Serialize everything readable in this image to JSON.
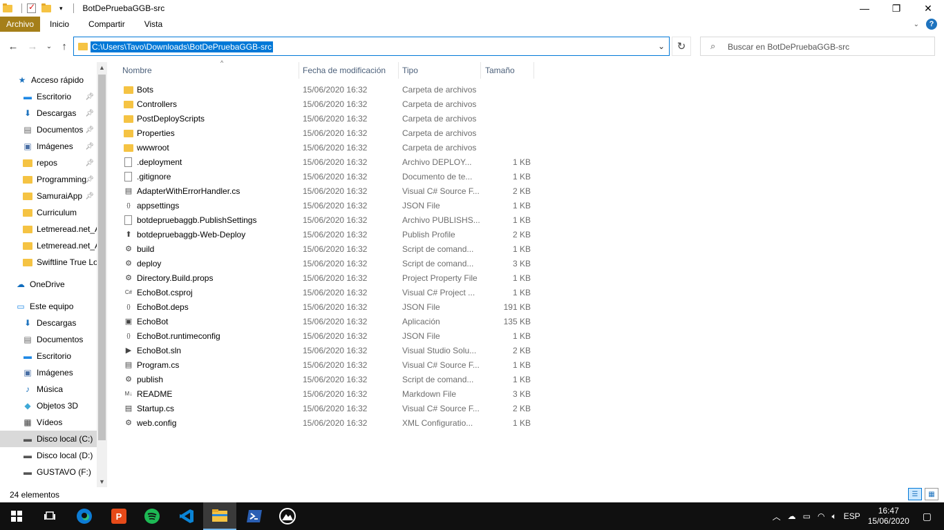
{
  "window": {
    "title": "BotDePruebaGGB-src",
    "controls": {
      "minimize": "—",
      "maximize": "❐",
      "close": "✕"
    }
  },
  "ribbon": {
    "tabs": [
      "Archivo",
      "Inicio",
      "Compartir",
      "Vista"
    ]
  },
  "address": {
    "path": "C:\\Users\\Tavo\\Downloads\\BotDePruebaGGB-src"
  },
  "search": {
    "placeholder": "Buscar en BotDePruebaGGB-src"
  },
  "nav": {
    "items": [
      {
        "label": "Acceso rápido",
        "icon": "star-icon",
        "pinned": false
      },
      {
        "label": "Escritorio",
        "icon": "desktop-icon",
        "pinned": true
      },
      {
        "label": "Descargas",
        "icon": "download-icon",
        "pinned": true
      },
      {
        "label": "Documentos",
        "icon": "documents-icon",
        "pinned": true
      },
      {
        "label": "Imágenes",
        "icon": "pictures-icon",
        "pinned": true
      },
      {
        "label": "repos",
        "icon": "folder-icon",
        "pinned": true
      },
      {
        "label": "Programming",
        "icon": "folder-icon",
        "pinned": true
      },
      {
        "label": "SamuraiApp",
        "icon": "folder-icon",
        "pinned": true
      },
      {
        "label": "Curriculum",
        "icon": "folder-icon",
        "pinned": false
      },
      {
        "label": "Letmeread.net_A",
        "icon": "folder-icon",
        "pinned": false
      },
      {
        "label": "Letmeread.net_A",
        "icon": "folder-icon",
        "pinned": false
      },
      {
        "label": "Swiftline True Lo",
        "icon": "folder-icon",
        "pinned": false
      },
      {
        "label": "OneDrive",
        "icon": "cloud-icon",
        "pinned": false
      },
      {
        "label": "Este equipo",
        "icon": "computer-icon",
        "pinned": false
      },
      {
        "label": "Descargas",
        "icon": "download-icon",
        "pinned": false
      },
      {
        "label": "Documentos",
        "icon": "documents-icon",
        "pinned": false
      },
      {
        "label": "Escritorio",
        "icon": "desktop-icon",
        "pinned": false
      },
      {
        "label": "Imágenes",
        "icon": "pictures-icon",
        "pinned": false
      },
      {
        "label": "Música",
        "icon": "music-icon",
        "pinned": false
      },
      {
        "label": "Objetos 3D",
        "icon": "3d-objects-icon",
        "pinned": false
      },
      {
        "label": "Vídeos",
        "icon": "videos-icon",
        "pinned": false
      },
      {
        "label": "Disco local (C:)",
        "icon": "drive-icon",
        "pinned": false
      },
      {
        "label": "Disco local (D:)",
        "icon": "drive-icon",
        "pinned": false
      },
      {
        "label": "GUSTAVO (F:)",
        "icon": "usb-drive-icon",
        "pinned": false
      }
    ],
    "selected_index": 21
  },
  "columns": {
    "name": "Nombre",
    "date": "Fecha de modificación",
    "type": "Tipo",
    "size": "Tamaño"
  },
  "files": [
    {
      "name": "Bots",
      "date": "15/06/2020 16:32",
      "type": "Carpeta de archivos",
      "size": "",
      "icon": "folder-icon"
    },
    {
      "name": "Controllers",
      "date": "15/06/2020 16:32",
      "type": "Carpeta de archivos",
      "size": "",
      "icon": "folder-icon"
    },
    {
      "name": "PostDeployScripts",
      "date": "15/06/2020 16:32",
      "type": "Carpeta de archivos",
      "size": "",
      "icon": "folder-icon"
    },
    {
      "name": "Properties",
      "date": "15/06/2020 16:32",
      "type": "Carpeta de archivos",
      "size": "",
      "icon": "folder-icon"
    },
    {
      "name": "wwwroot",
      "date": "15/06/2020 16:32",
      "type": "Carpeta de archivos",
      "size": "",
      "icon": "folder-icon"
    },
    {
      "name": ".deployment",
      "date": "15/06/2020 16:32",
      "type": "Archivo DEPLOY...",
      "size": "1 KB",
      "icon": "file-icon"
    },
    {
      "name": ".gitignore",
      "date": "15/06/2020 16:32",
      "type": "Documento de te...",
      "size": "1 KB",
      "icon": "file-icon"
    },
    {
      "name": "AdapterWithErrorHandler.cs",
      "date": "15/06/2020 16:32",
      "type": "Visual C# Source F...",
      "size": "2 KB",
      "icon": "csharp-source-icon"
    },
    {
      "name": "appsettings",
      "date": "15/06/2020 16:32",
      "type": "JSON File",
      "size": "1 KB",
      "icon": "json-icon"
    },
    {
      "name": "botdepruebaggb.PublishSettings",
      "date": "15/06/2020 16:32",
      "type": "Archivo PUBLISHS...",
      "size": "1 KB",
      "icon": "file-icon"
    },
    {
      "name": "botdepruebaggb-Web-Deploy",
      "date": "15/06/2020 16:32",
      "type": "Publish Profile",
      "size": "2 KB",
      "icon": "publish-profile-icon"
    },
    {
      "name": "build",
      "date": "15/06/2020 16:32",
      "type": "Script de comand...",
      "size": "1 KB",
      "icon": "script-icon"
    },
    {
      "name": "deploy",
      "date": "15/06/2020 16:32",
      "type": "Script de comand...",
      "size": "3 KB",
      "icon": "script-icon"
    },
    {
      "name": "Directory.Build.props",
      "date": "15/06/2020 16:32",
      "type": "Project Property File",
      "size": "1 KB",
      "icon": "props-icon"
    },
    {
      "name": "EchoBot.csproj",
      "date": "15/06/2020 16:32",
      "type": "Visual C# Project ...",
      "size": "1 KB",
      "icon": "csproj-icon"
    },
    {
      "name": "EchoBot.deps",
      "date": "15/06/2020 16:32",
      "type": "JSON File",
      "size": "191 KB",
      "icon": "json-icon"
    },
    {
      "name": "EchoBot",
      "date": "15/06/2020 16:32",
      "type": "Aplicación",
      "size": "135 KB",
      "icon": "application-icon"
    },
    {
      "name": "EchoBot.runtimeconfig",
      "date": "15/06/2020 16:32",
      "type": "JSON File",
      "size": "1 KB",
      "icon": "json-icon"
    },
    {
      "name": "EchoBot.sln",
      "date": "15/06/2020 16:32",
      "type": "Visual Studio Solu...",
      "size": "2 KB",
      "icon": "solution-icon"
    },
    {
      "name": "Program.cs",
      "date": "15/06/2020 16:32",
      "type": "Visual C# Source F...",
      "size": "1 KB",
      "icon": "csharp-source-icon"
    },
    {
      "name": "publish",
      "date": "15/06/2020 16:32",
      "type": "Script de comand...",
      "size": "1 KB",
      "icon": "script-icon"
    },
    {
      "name": "README",
      "date": "15/06/2020 16:32",
      "type": "Markdown File",
      "size": "3 KB",
      "icon": "markdown-icon"
    },
    {
      "name": "Startup.cs",
      "date": "15/06/2020 16:32",
      "type": "Visual C# Source F...",
      "size": "2 KB",
      "icon": "csharp-source-icon"
    },
    {
      "name": "web.config",
      "date": "15/06/2020 16:32",
      "type": "XML Configuratio...",
      "size": "1 KB",
      "icon": "xml-config-icon"
    }
  ],
  "status": {
    "count": "24 elementos"
  },
  "taskbar": {
    "apps": [
      "start-icon",
      "task-view-icon",
      "edge-icon",
      "office-icon",
      "spotify-icon",
      "vscode-icon",
      "file-explorer-icon",
      "powershell-icon",
      "media-icon"
    ],
    "active_app": "file-explorer-icon",
    "language": "ESP",
    "time": "16:47",
    "date": "15/06/2020"
  },
  "colors": {
    "accent": "#0078d7",
    "file_tab": "#a57f19",
    "folder": "#f5c343",
    "taskbar": "#101010"
  }
}
